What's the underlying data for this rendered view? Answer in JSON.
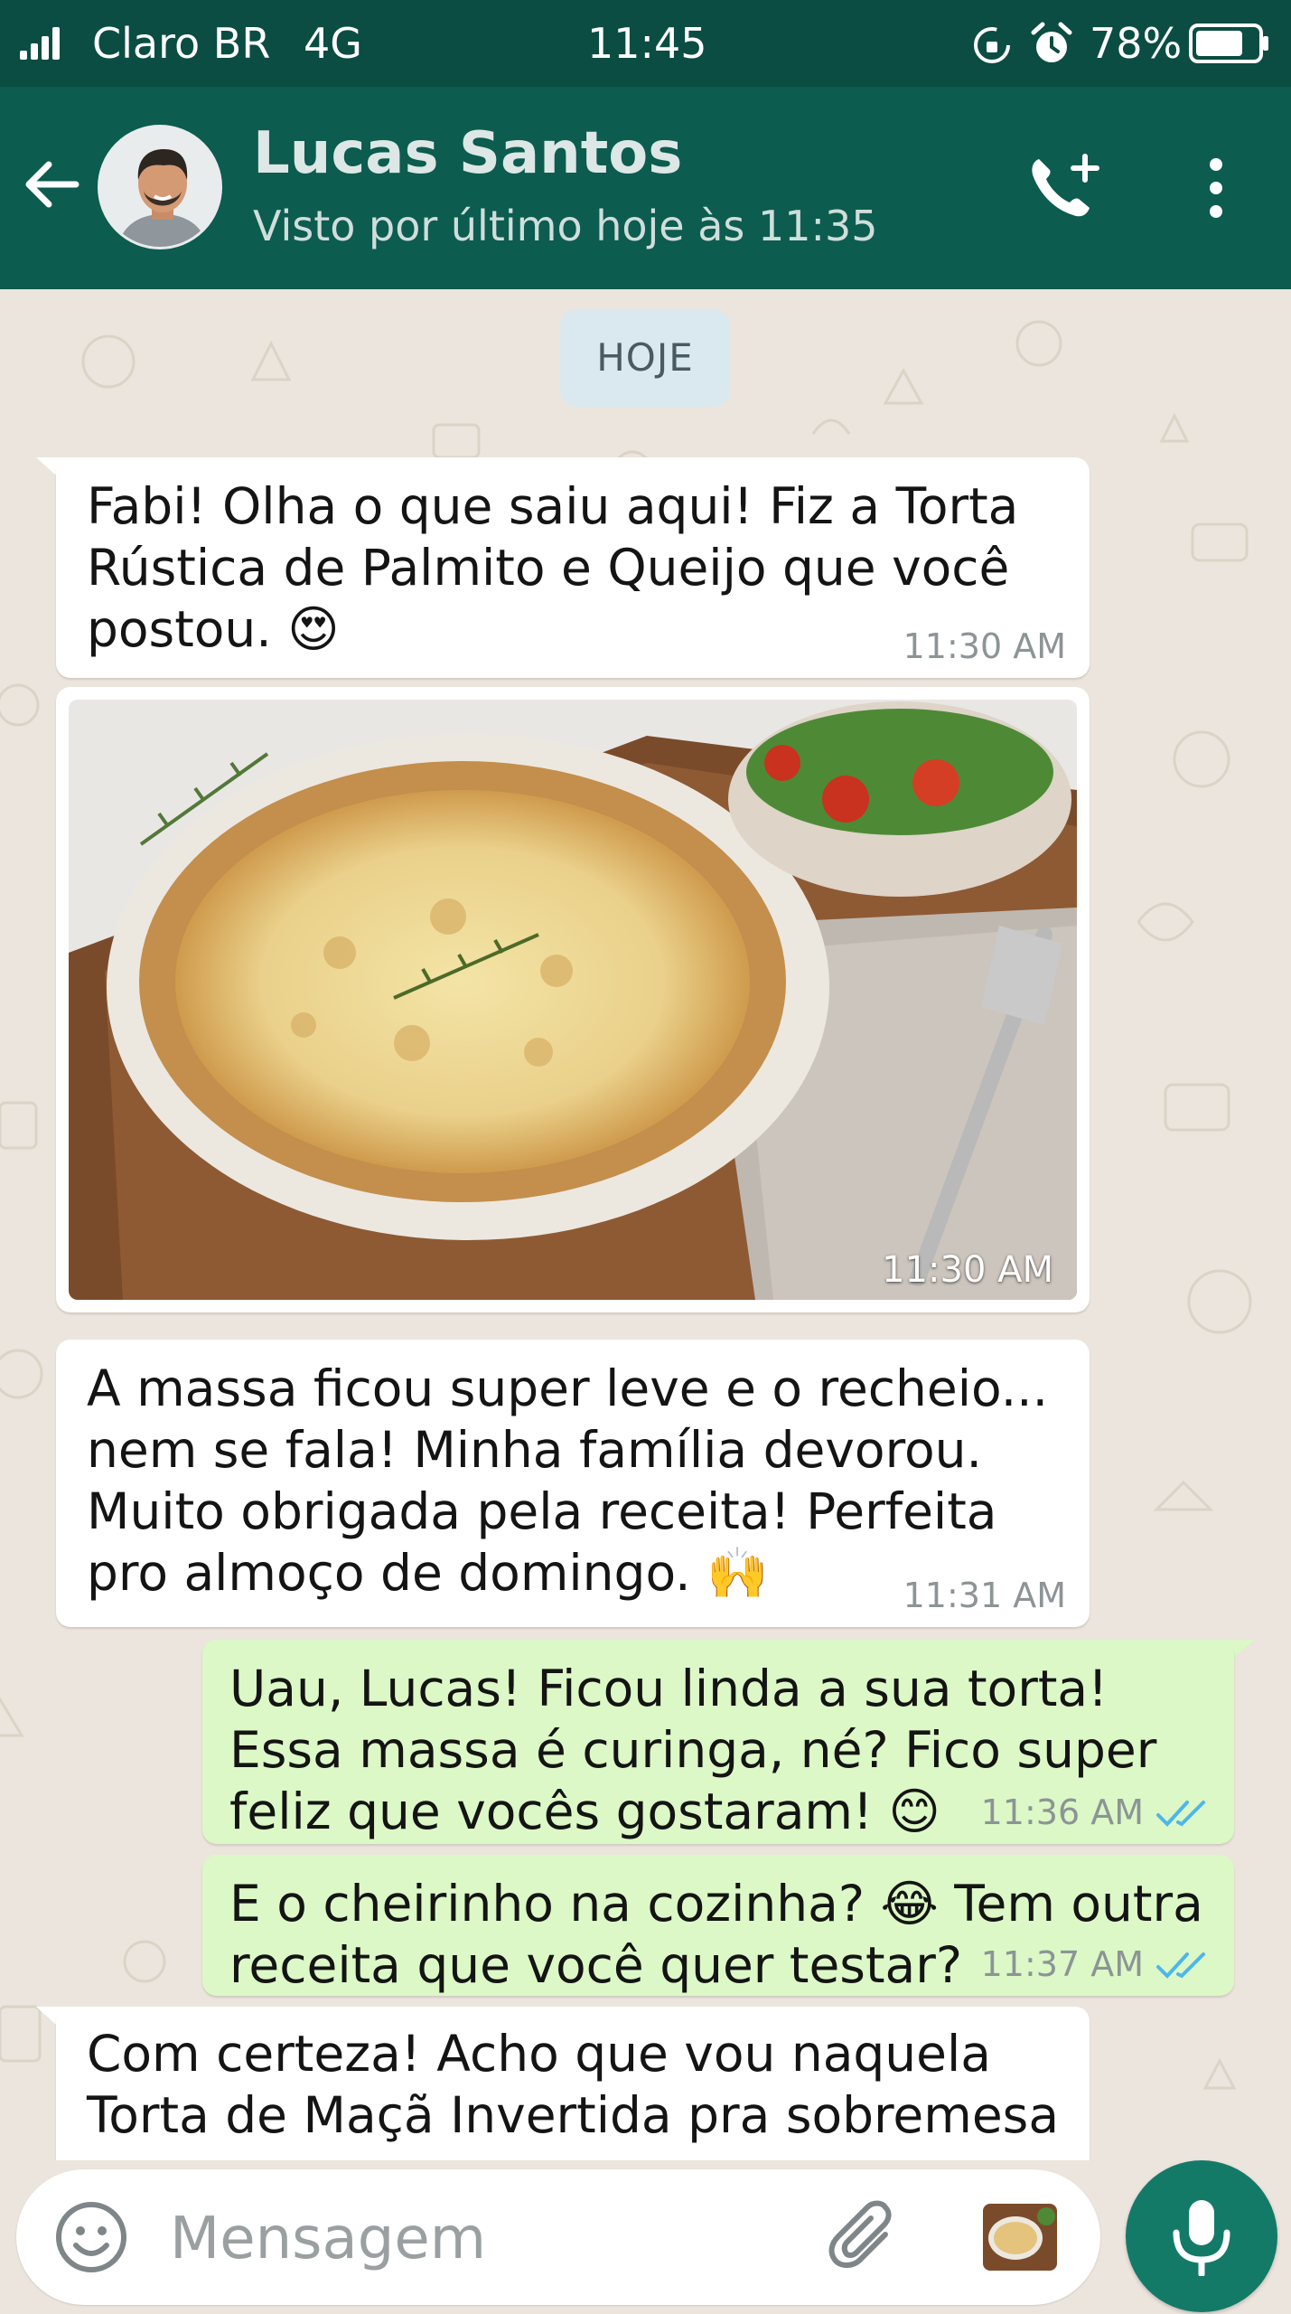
{
  "status_bar": {
    "carrier": "Claro BR",
    "network": "4G",
    "time": "11:45",
    "battery_percent": "78%",
    "battery_level": 0.78
  },
  "header": {
    "contact_name": "Lucas Santos",
    "last_seen": "Visto por último hoje às 11:35",
    "icons": [
      "back-arrow-icon",
      "avatar",
      "add-call-icon",
      "more-vert-icon"
    ]
  },
  "chat": {
    "date_chip": "HOJE",
    "messages": [
      {
        "direction": "incoming",
        "text": "Fabi! Olha o que saiu aqui! Fiz a Torta Rústica de Palmito e Queijo que você postou. 😍",
        "time": "11:30 AM"
      },
      {
        "direction": "incoming",
        "type": "photo",
        "time": "11:30 AM"
      },
      {
        "direction": "incoming",
        "text": "A massa ficou super leve e o recheio... nem se fala! Minha família devorou. Muito obrigada pela receita! Perfeita pro almoço de domingo. 🙌",
        "time": "11:31 AM"
      },
      {
        "direction": "outgoing",
        "text": "Uau, Lucas! Ficou linda a sua torta! Essa massa é curinga, né? Fico super feliz que vocês gostaram! 😊",
        "time": "11:36 AM",
        "status": "read"
      },
      {
        "direction": "outgoing",
        "text": "E o cheirinho na cozinha? 😂 Tem outra receita que você quer testar?",
        "time": "11:37 AM",
        "status": "read"
      },
      {
        "direction": "incoming",
        "text": "Com certeza! Acho que vou naquela Torta de Maçã Invertida pra sobremesa"
      }
    ]
  },
  "input_bar": {
    "placeholder": "Mensagem",
    "icons": [
      "emoji-icon",
      "attach-icon",
      "gallery-thumbnail",
      "mic-icon"
    ]
  },
  "colors": {
    "header": "#0c5c4f",
    "status_bar": "#0b4d43",
    "chat_bg": "#ece5dd",
    "outgoing_bubble": "#dcf8c6",
    "incoming_bubble": "#ffffff",
    "read_ticks": "#4fb6ec",
    "mic_button": "#137a68"
  }
}
